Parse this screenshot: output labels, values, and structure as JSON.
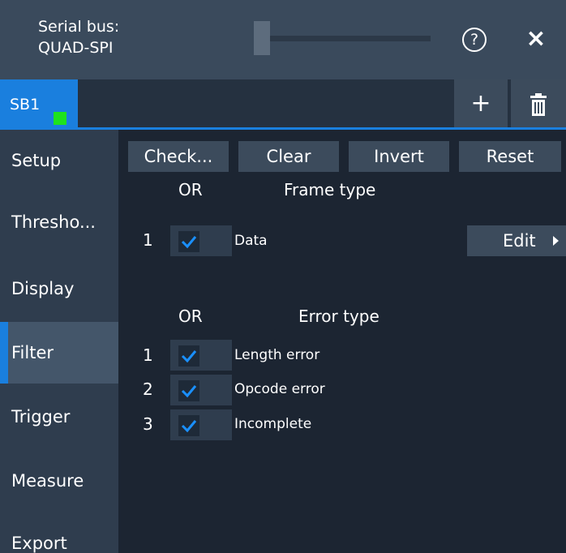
{
  "header": {
    "title_line1": "Serial bus:",
    "title_line2": "QUAD-SPI",
    "help_icon": "?",
    "close_icon": "×"
  },
  "tabs": {
    "sb1_label": "SB1",
    "add_label": "+",
    "indicator_color": "#1ee21e",
    "accent_color": "#1a7fde"
  },
  "nav": {
    "items": [
      {
        "label": "Setup"
      },
      {
        "label": "Thresho..."
      },
      {
        "label": "Display"
      },
      {
        "label": "Filter"
      },
      {
        "label": "Trigger"
      },
      {
        "label": "Measure"
      },
      {
        "label": "Export"
      }
    ],
    "active": "Filter"
  },
  "main": {
    "buttons": {
      "check": "Check...",
      "clear": "Clear",
      "invert": "Invert",
      "reset": "Reset"
    },
    "frame_section": {
      "or_label": "OR",
      "title": "Frame type",
      "rows": [
        {
          "num": "1",
          "label": "Data",
          "checked": true
        }
      ],
      "edit_label": "Edit"
    },
    "error_section": {
      "or_label": "OR",
      "title": "Error type",
      "rows": [
        {
          "num": "1",
          "label": "Length error",
          "checked": true
        },
        {
          "num": "2",
          "label": "Opcode error",
          "checked": true
        },
        {
          "num": "3",
          "label": "Incomplete",
          "checked": true
        }
      ]
    }
  }
}
